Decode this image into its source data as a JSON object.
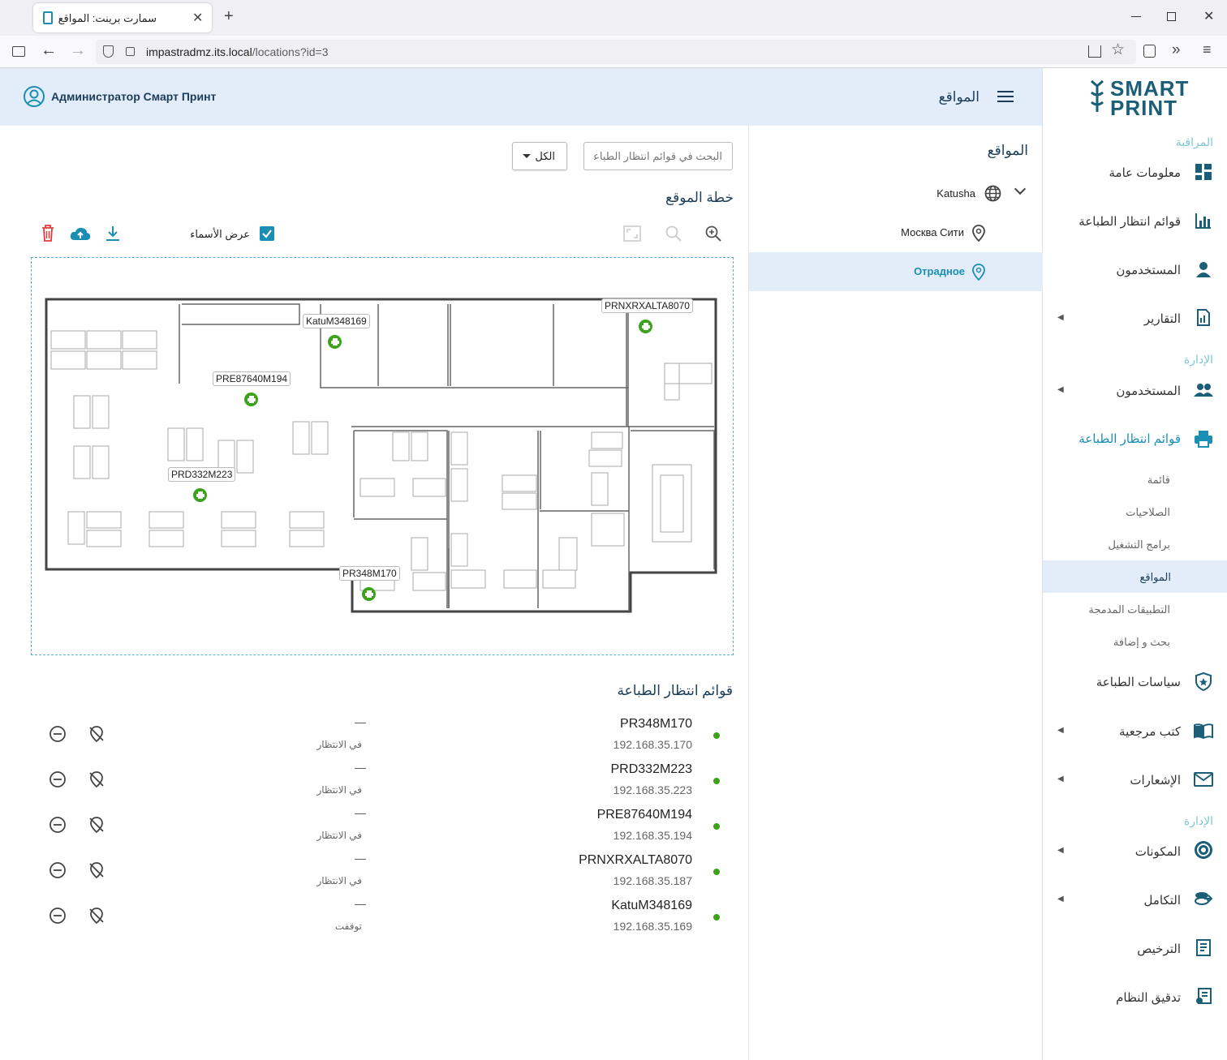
{
  "browser": {
    "tab_title": "سمارت برينت: المواقع",
    "url_host": "impastradmz.its.local",
    "url_path": "/locations?id=3"
  },
  "header": {
    "user_name": "Администратор Смарт Принт",
    "page_title": "المواقع"
  },
  "logo": {
    "line1": "SMART",
    "line2": "PRINT"
  },
  "sidebar": {
    "section_monitoring": "المراقبة",
    "section_admin": "الإدارة",
    "section_admin2": "الإدارة",
    "items": [
      {
        "label": "معلومات عامة",
        "icon": "dashboard-icon"
      },
      {
        "label": "قوائم انتظار الطباعة",
        "icon": "bar-chart-icon"
      },
      {
        "label": "المستخدمون",
        "icon": "user-icon"
      },
      {
        "label": "التقارير",
        "icon": "report-icon"
      },
      {
        "label": "المستخدمون",
        "icon": "users-icon"
      },
      {
        "label": "قوائم انتظار الطباعة",
        "icon": "printer-icon"
      },
      {
        "label": "سياسات الطباعة",
        "icon": "shield-icon"
      },
      {
        "label": "كتب مرجعية",
        "icon": "book-icon"
      },
      {
        "label": "الإشعارات",
        "icon": "mail-icon"
      },
      {
        "label": "المكونات",
        "icon": "components-icon"
      },
      {
        "label": "التكامل",
        "icon": "integration-icon"
      },
      {
        "label": "الترخيص",
        "icon": "license-icon"
      },
      {
        "label": "تدقيق النظام",
        "icon": "audit-icon"
      }
    ],
    "subitems": [
      "قائمة",
      "الصلاحيات",
      "برامج التشغيل",
      "المواقع",
      "التطبيقات المدمجة",
      "بحث و إضافة"
    ]
  },
  "locations_tree": {
    "title": "المواقع",
    "root": "Katusha",
    "children": [
      "Москва Сити",
      "Отрадное"
    ],
    "selected": "Отрадное"
  },
  "toolbar": {
    "search_placeholder": "البحث في قوائم انتظار الطباعة",
    "filter_value": "الكل",
    "plan_title": "خطة الموقع",
    "show_names_label": "عرض الأسماء",
    "show_names_checked": true
  },
  "floorplan": {
    "labels": [
      "KatuM348169",
      "PRE87640M194",
      "PRD332M223",
      "PRNXRXALTA8070",
      "PR348M170"
    ]
  },
  "queues": {
    "title": "قوائم انتظار الطباعة",
    "items": [
      {
        "name": "PR348M170",
        "ip": "192.168.35.170",
        "dash": "—",
        "state": "في الانتظار"
      },
      {
        "name": "PRD332M223",
        "ip": "192.168.35.223",
        "dash": "—",
        "state": "في الانتظار"
      },
      {
        "name": "PRE87640M194",
        "ip": "192.168.35.194",
        "dash": "—",
        "state": "في الانتظار"
      },
      {
        "name": "PRNXRXALTA8070",
        "ip": "192.168.35.187",
        "dash": "—",
        "state": "في الانتظار"
      },
      {
        "name": "KatuM348169",
        "ip": "192.168.35.169",
        "dash": "—",
        "state": "توقفت"
      }
    ]
  },
  "colors": {
    "accent": "#1a8fb3",
    "header_bg": "#e3edf9",
    "status_ok": "#3aa21b",
    "delete": "#e53935"
  }
}
